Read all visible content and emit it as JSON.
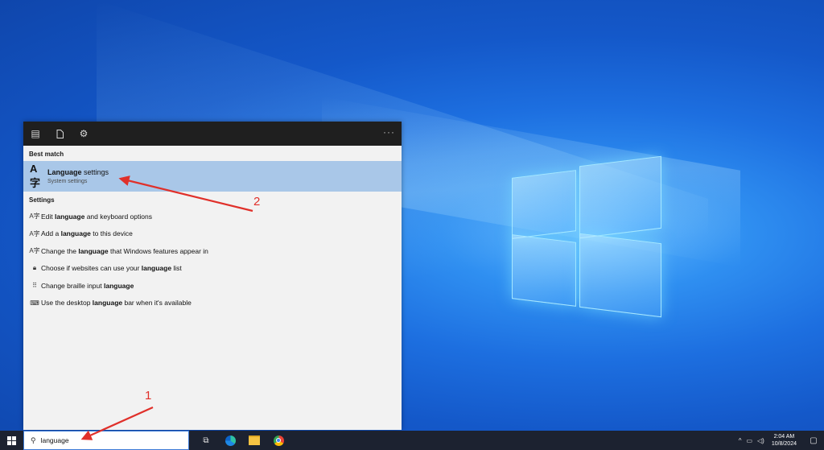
{
  "search_panel": {
    "toolbar_icons": [
      "apps-icon",
      "document-icon",
      "gear-icon"
    ],
    "more_label": "···",
    "best_match_title": "Best match",
    "best_match": {
      "title_bold": "Language",
      "title_rest": " settings",
      "subtitle": "System settings",
      "icon": "language-icon"
    },
    "settings_title": "Settings",
    "settings_items": [
      {
        "icon": "language-icon",
        "pre": "Edit ",
        "bold": "language",
        "post": " and keyboard options"
      },
      {
        "icon": "language-icon",
        "pre": "Add a ",
        "bold": "language",
        "post": " to this device"
      },
      {
        "icon": "language-icon",
        "pre": "Change the ",
        "bold": "language",
        "post": " that Windows features appear in"
      },
      {
        "icon": "lock-icon",
        "pre": "Choose if websites can use your ",
        "bold": "language",
        "post": " list"
      },
      {
        "icon": "braille-icon",
        "pre": "Change braille input ",
        "bold": "language",
        "post": ""
      },
      {
        "icon": "keyboard-icon",
        "pre": "Use the desktop ",
        "bold": "language",
        "post": " bar when it's available"
      }
    ]
  },
  "taskbar": {
    "search_value": "language",
    "time": "2:04 AM",
    "date": "10/8/2024",
    "tray_icons": [
      "chevron-up-icon",
      "network-icon",
      "volume-icon"
    ]
  },
  "annotations": {
    "label_1": "1",
    "label_2": "2",
    "color": "#e0302a"
  }
}
